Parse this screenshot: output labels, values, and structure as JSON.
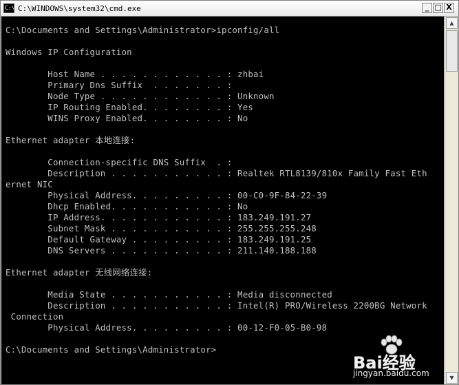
{
  "window": {
    "title": "C:\\WINDOWS\\system32\\cmd.exe",
    "icon_label": "C:\\",
    "buttons": {
      "minimize": "_",
      "maximize": "□",
      "close": "X"
    }
  },
  "console": {
    "lines": [
      "C:\\Documents and Settings\\Administrator>ipconfig/all",
      "",
      "Windows IP Configuration",
      "",
      "        Host Name . . . . . . . . . . . . : zhbai",
      "        Primary Dns Suffix  . . . . . . . :",
      "        Node Type . . . . . . . . . . . . : Unknown",
      "        IP Routing Enabled. . . . . . . . : Yes",
      "        WINS Proxy Enabled. . . . . . . . : No",
      "",
      "Ethernet adapter 本地连接:",
      "",
      "        Connection-specific DNS Suffix  . :",
      "        Description . . . . . . . . . . . : Realtek RTL8139/810x Family Fast Eth",
      "ernet NIC",
      "        Physical Address. . . . . . . . . : 00-C0-9F-84-22-39",
      "        Dhcp Enabled. . . . . . . . . . . : No",
      "        IP Address. . . . . . . . . . . . : 183.249.191.27",
      "        Subnet Mask . . . . . . . . . . . : 255.255.255.248",
      "        Default Gateway . . . . . . . . . : 183.249.191.25",
      "        DNS Servers . . . . . . . . . . . : 211.140.188.188",
      "",
      "Ethernet adapter 无线网络连接:",
      "",
      "        Media State . . . . . . . . . . . : Media disconnected",
      "        Description . . . . . . . . . . . : Intel(R) PRO/Wireless 2200BG Network",
      " Connection",
      "        Physical Address. . . . . . . . . : 00-12-F0-05-B0-98",
      "",
      "C:\\Documents and Settings\\Administrator>"
    ]
  },
  "scrollbar": {
    "up_arrow": "▲",
    "down_arrow": "▼"
  },
  "watermark": {
    "brand": "Bai经验",
    "url": "jingyan.baidu.com"
  }
}
